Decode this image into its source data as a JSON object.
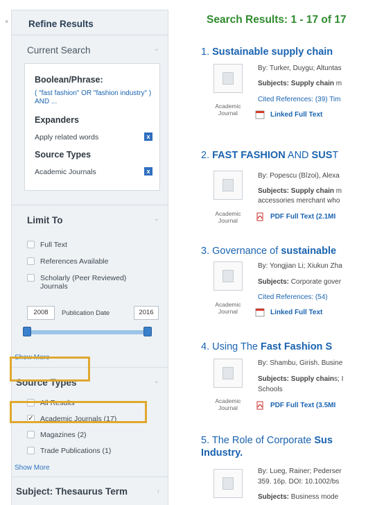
{
  "sidebar": {
    "collapse_icon": "×",
    "title": "Refine Results",
    "current_search": {
      "heading": "Current Search",
      "boolean_label": "Boolean/Phrase:",
      "query": "( \"fast fashion\" OR \"fashion industry\" ) AND ...",
      "expanders_label": "Expanders",
      "expander_item": "Apply related words",
      "source_types_label": "Source Types",
      "source_type_item": "Academic Journals",
      "remove_icon": "x"
    },
    "limit_to": {
      "heading": "Limit To",
      "options": [
        "Full Text",
        "References Available",
        "Scholarly (Peer Reviewed) Journals"
      ],
      "date_from": "2008",
      "date_label": "Publication Date",
      "date_to": "2016",
      "show_more": "Show More"
    },
    "source_types": {
      "heading": "Source Types",
      "options": [
        "All Results",
        "Academic Journals (17)",
        "Magazines (2)",
        "Trade Publications (1)"
      ],
      "checked_index": 1,
      "show_more": "Show More"
    },
    "subject_thesaurus": "Subject: Thesaurus Term",
    "accent_color": "#e0a82e"
  },
  "results": {
    "header": "Search Results: 1 - 17 of 17",
    "items": [
      {
        "num": "1.",
        "title_html": "<b>Sustainable supply chain</b>",
        "doc_type": "Academic Journal",
        "byline": "By: Turker, Duygu; Altuntas",
        "subjects": "Subjects: Supply chain m",
        "cited": "Cited References: (39) Tim",
        "fulltext": "Linked Full Text"
      },
      {
        "num": "2.",
        "title_html": "<b>FAST FASHION</b> AND <b>SUS</b>T",
        "doc_type": "Academic Journal",
        "byline": "By: Popescu (Bîzoi), Alexa",
        "subjects": "Subjects: Supply chain m",
        "subjects2": "accessories merchant who",
        "fulltext": "PDF Full Text (2.1MI"
      },
      {
        "num": "3.",
        "title_html": "Governance of <b>sustainable</b>",
        "doc_type": "Academic Journal",
        "byline": "By: Yongjian Li; Xiukun Zha",
        "subjects": "Subjects: Corporate gover",
        "cited": "Cited References: (54)",
        "fulltext": "Linked Full Text"
      },
      {
        "num": "4.",
        "title_html": "Using The <b>Fast Fashion S</b>",
        "doc_type": "Academic Journal",
        "byline": "By: Shambu, Girish. Busine",
        "subjects": "Subjects: Supply chains; I",
        "subjects2": "Schools",
        "fulltext": "PDF Full Text (3.5MI"
      },
      {
        "num": "5.",
        "title_html": "The Role of Corporate <b>Sus</b>",
        "title_line2": "Industry.",
        "byline": "By: Lueg, Rainer; Pederser",
        "byline2": "359. 16p. DOI: 10.1002/bs",
        "subjects": "Subjects: Business mode"
      }
    ]
  }
}
